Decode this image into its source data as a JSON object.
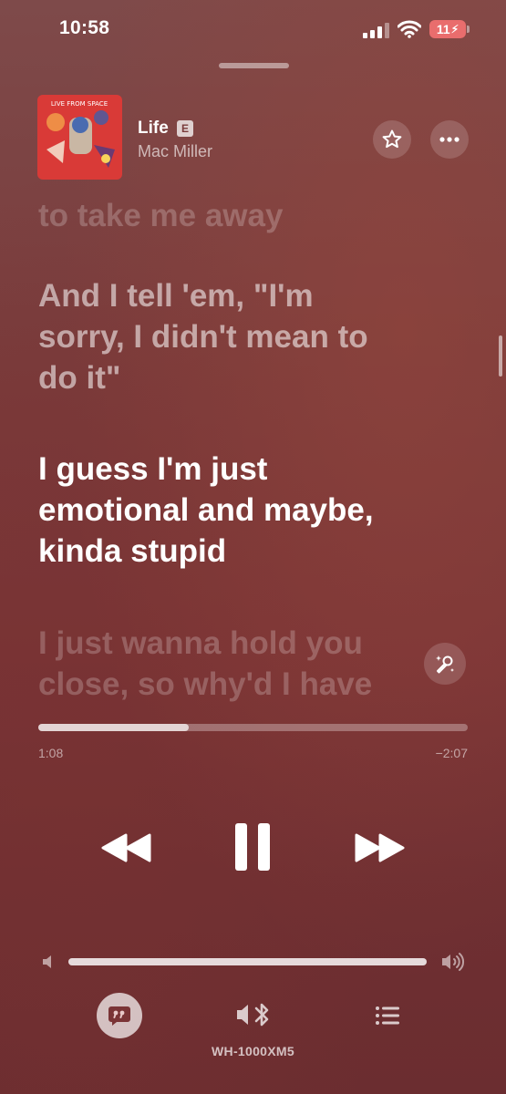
{
  "status_bar": {
    "time": "10:58",
    "battery": "11"
  },
  "now_playing": {
    "title": "Life",
    "explicit_badge": "E",
    "artist": "Mac Miller",
    "album_art_text": "LIVE FROM SPACE"
  },
  "lyrics": {
    "previous": [
      "to take me away"
    ],
    "past": [
      "And I tell 'em, \"I'm",
      "sorry, I didn't mean to",
      "do it\""
    ],
    "current": [
      "I guess I'm just",
      "emotional and maybe,",
      "kinda stupid"
    ],
    "upcoming": [
      "I just wanna hold you",
      "close, so why'd I have"
    ]
  },
  "playback": {
    "elapsed": "1:08",
    "remaining": "−2:07",
    "progress_fraction": 0.35,
    "volume_fraction": 1.0
  },
  "output": {
    "device_name": "WH-1000XM5"
  },
  "icons": {
    "star": "star-icon",
    "more": "more-icon",
    "sing": "microphone-sparkle-icon",
    "rewind": "rewind-icon",
    "pause": "pause-icon",
    "forward": "fast-forward-icon",
    "lyrics": "lyrics-quote-icon",
    "airplay": "bluetooth-speaker-icon",
    "queue": "queue-list-icon"
  },
  "colors": {
    "battery_low": "#e96d6d",
    "background": "#7a3436"
  }
}
